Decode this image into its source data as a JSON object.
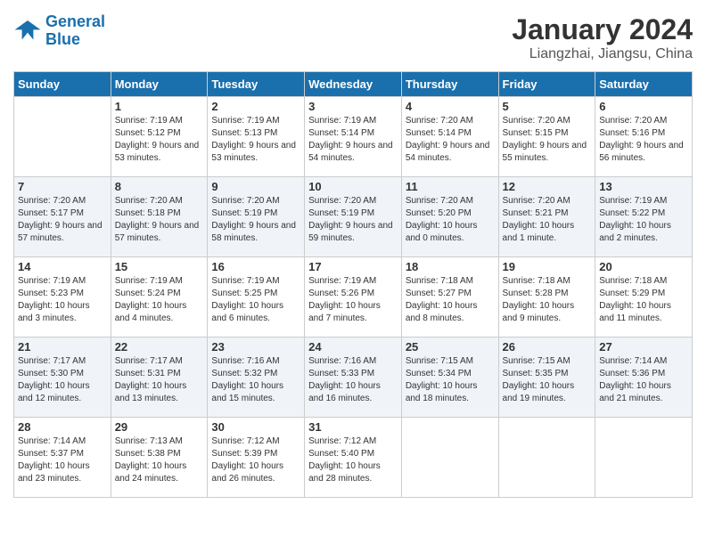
{
  "header": {
    "logo_general": "General",
    "logo_blue": "Blue",
    "month_title": "January 2024",
    "location": "Liangzhai, Jiangsu, China"
  },
  "days_of_week": [
    "Sunday",
    "Monday",
    "Tuesday",
    "Wednesday",
    "Thursday",
    "Friday",
    "Saturday"
  ],
  "weeks": [
    [
      {
        "day": "",
        "sunrise": "",
        "sunset": "",
        "daylight": ""
      },
      {
        "day": "1",
        "sunrise": "Sunrise: 7:19 AM",
        "sunset": "Sunset: 5:12 PM",
        "daylight": "Daylight: 9 hours and 53 minutes."
      },
      {
        "day": "2",
        "sunrise": "Sunrise: 7:19 AM",
        "sunset": "Sunset: 5:13 PM",
        "daylight": "Daylight: 9 hours and 53 minutes."
      },
      {
        "day": "3",
        "sunrise": "Sunrise: 7:19 AM",
        "sunset": "Sunset: 5:14 PM",
        "daylight": "Daylight: 9 hours and 54 minutes."
      },
      {
        "day": "4",
        "sunrise": "Sunrise: 7:20 AM",
        "sunset": "Sunset: 5:14 PM",
        "daylight": "Daylight: 9 hours and 54 minutes."
      },
      {
        "day": "5",
        "sunrise": "Sunrise: 7:20 AM",
        "sunset": "Sunset: 5:15 PM",
        "daylight": "Daylight: 9 hours and 55 minutes."
      },
      {
        "day": "6",
        "sunrise": "Sunrise: 7:20 AM",
        "sunset": "Sunset: 5:16 PM",
        "daylight": "Daylight: 9 hours and 56 minutes."
      }
    ],
    [
      {
        "day": "7",
        "sunrise": "Sunrise: 7:20 AM",
        "sunset": "Sunset: 5:17 PM",
        "daylight": "Daylight: 9 hours and 57 minutes."
      },
      {
        "day": "8",
        "sunrise": "Sunrise: 7:20 AM",
        "sunset": "Sunset: 5:18 PM",
        "daylight": "Daylight: 9 hours and 57 minutes."
      },
      {
        "day": "9",
        "sunrise": "Sunrise: 7:20 AM",
        "sunset": "Sunset: 5:19 PM",
        "daylight": "Daylight: 9 hours and 58 minutes."
      },
      {
        "day": "10",
        "sunrise": "Sunrise: 7:20 AM",
        "sunset": "Sunset: 5:19 PM",
        "daylight": "Daylight: 9 hours and 59 minutes."
      },
      {
        "day": "11",
        "sunrise": "Sunrise: 7:20 AM",
        "sunset": "Sunset: 5:20 PM",
        "daylight": "Daylight: 10 hours and 0 minutes."
      },
      {
        "day": "12",
        "sunrise": "Sunrise: 7:20 AM",
        "sunset": "Sunset: 5:21 PM",
        "daylight": "Daylight: 10 hours and 1 minute."
      },
      {
        "day": "13",
        "sunrise": "Sunrise: 7:19 AM",
        "sunset": "Sunset: 5:22 PM",
        "daylight": "Daylight: 10 hours and 2 minutes."
      }
    ],
    [
      {
        "day": "14",
        "sunrise": "Sunrise: 7:19 AM",
        "sunset": "Sunset: 5:23 PM",
        "daylight": "Daylight: 10 hours and 3 minutes."
      },
      {
        "day": "15",
        "sunrise": "Sunrise: 7:19 AM",
        "sunset": "Sunset: 5:24 PM",
        "daylight": "Daylight: 10 hours and 4 minutes."
      },
      {
        "day": "16",
        "sunrise": "Sunrise: 7:19 AM",
        "sunset": "Sunset: 5:25 PM",
        "daylight": "Daylight: 10 hours and 6 minutes."
      },
      {
        "day": "17",
        "sunrise": "Sunrise: 7:19 AM",
        "sunset": "Sunset: 5:26 PM",
        "daylight": "Daylight: 10 hours and 7 minutes."
      },
      {
        "day": "18",
        "sunrise": "Sunrise: 7:18 AM",
        "sunset": "Sunset: 5:27 PM",
        "daylight": "Daylight: 10 hours and 8 minutes."
      },
      {
        "day": "19",
        "sunrise": "Sunrise: 7:18 AM",
        "sunset": "Sunset: 5:28 PM",
        "daylight": "Daylight: 10 hours and 9 minutes."
      },
      {
        "day": "20",
        "sunrise": "Sunrise: 7:18 AM",
        "sunset": "Sunset: 5:29 PM",
        "daylight": "Daylight: 10 hours and 11 minutes."
      }
    ],
    [
      {
        "day": "21",
        "sunrise": "Sunrise: 7:17 AM",
        "sunset": "Sunset: 5:30 PM",
        "daylight": "Daylight: 10 hours and 12 minutes."
      },
      {
        "day": "22",
        "sunrise": "Sunrise: 7:17 AM",
        "sunset": "Sunset: 5:31 PM",
        "daylight": "Daylight: 10 hours and 13 minutes."
      },
      {
        "day": "23",
        "sunrise": "Sunrise: 7:16 AM",
        "sunset": "Sunset: 5:32 PM",
        "daylight": "Daylight: 10 hours and 15 minutes."
      },
      {
        "day": "24",
        "sunrise": "Sunrise: 7:16 AM",
        "sunset": "Sunset: 5:33 PM",
        "daylight": "Daylight: 10 hours and 16 minutes."
      },
      {
        "day": "25",
        "sunrise": "Sunrise: 7:15 AM",
        "sunset": "Sunset: 5:34 PM",
        "daylight": "Daylight: 10 hours and 18 minutes."
      },
      {
        "day": "26",
        "sunrise": "Sunrise: 7:15 AM",
        "sunset": "Sunset: 5:35 PM",
        "daylight": "Daylight: 10 hours and 19 minutes."
      },
      {
        "day": "27",
        "sunrise": "Sunrise: 7:14 AM",
        "sunset": "Sunset: 5:36 PM",
        "daylight": "Daylight: 10 hours and 21 minutes."
      }
    ],
    [
      {
        "day": "28",
        "sunrise": "Sunrise: 7:14 AM",
        "sunset": "Sunset: 5:37 PM",
        "daylight": "Daylight: 10 hours and 23 minutes."
      },
      {
        "day": "29",
        "sunrise": "Sunrise: 7:13 AM",
        "sunset": "Sunset: 5:38 PM",
        "daylight": "Daylight: 10 hours and 24 minutes."
      },
      {
        "day": "30",
        "sunrise": "Sunrise: 7:12 AM",
        "sunset": "Sunset: 5:39 PM",
        "daylight": "Daylight: 10 hours and 26 minutes."
      },
      {
        "day": "31",
        "sunrise": "Sunrise: 7:12 AM",
        "sunset": "Sunset: 5:40 PM",
        "daylight": "Daylight: 10 hours and 28 minutes."
      },
      {
        "day": "",
        "sunrise": "",
        "sunset": "",
        "daylight": ""
      },
      {
        "day": "",
        "sunrise": "",
        "sunset": "",
        "daylight": ""
      },
      {
        "day": "",
        "sunrise": "",
        "sunset": "",
        "daylight": ""
      }
    ]
  ]
}
